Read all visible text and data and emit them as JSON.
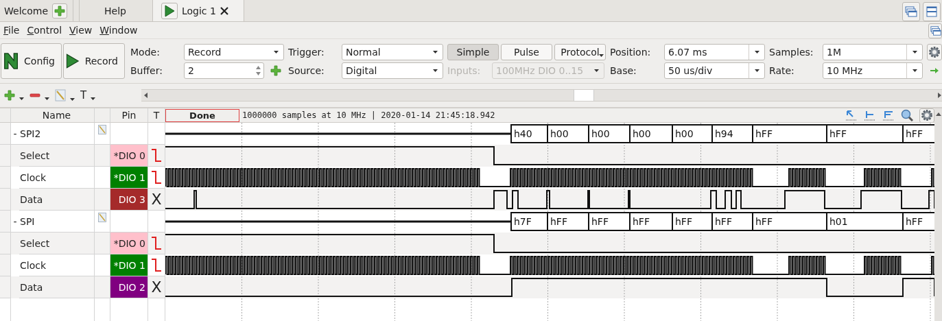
{
  "tabs": [
    {
      "label": "Welcome",
      "kind": "addable",
      "selected": false,
      "closable": false
    },
    {
      "label": "Help",
      "kind": "plain",
      "selected": false,
      "closable": false
    },
    {
      "label": "Logic 1",
      "kind": "runnable",
      "selected": true,
      "closable": true
    }
  ],
  "menu": [
    "File",
    "Control",
    "View",
    "Window"
  ],
  "actions": [
    {
      "label": "Config",
      "kind": "config"
    },
    {
      "label": "Record",
      "kind": "record"
    }
  ],
  "settings": {
    "mode": {
      "label": "Mode:",
      "value": "Record"
    },
    "buffer": {
      "label": "Buffer:",
      "value": "2"
    },
    "trigger": {
      "label": "Trigger:",
      "value": "Normal"
    },
    "source": {
      "label": "Source:",
      "value": "Digital"
    },
    "trigger_types": [
      {
        "label": "Simple",
        "selected": true,
        "menu": false
      },
      {
        "label": "Pulse",
        "selected": false,
        "menu": false
      },
      {
        "label": "Protocol",
        "selected": false,
        "menu": true
      }
    ],
    "inputs": {
      "label": "Inputs:",
      "value": "100MHz DIO 0..15",
      "disabled": true
    },
    "position": {
      "label": "Position:",
      "value": "6.07 ms"
    },
    "base": {
      "label": "Base:",
      "value": "50 us/div"
    },
    "samples": {
      "label": "Samples:",
      "value": "1M"
    },
    "rate": {
      "label": "Rate:",
      "value": "10 MHz"
    }
  },
  "edit_tools": [
    {
      "kind": "add"
    },
    {
      "kind": "remove"
    },
    {
      "kind": "pencil"
    },
    {
      "kind": "text",
      "text": "T"
    }
  ],
  "capture": {
    "status": "Done",
    "info": "1000000 samples at 10 MHz | 2020-01-14 21:45:18.942"
  },
  "columns": [
    "Name",
    "Pin",
    "T"
  ],
  "groups": [
    {
      "name": "SPI2",
      "toggle": "-",
      "expanded": true,
      "bus_values": [
        "h40",
        "h00",
        "h00",
        "h00",
        "h00",
        "h94",
        "hFF",
        "hFF",
        "hFF"
      ],
      "children": [
        {
          "name": "Select",
          "pin": "*DIO 0",
          "color": "#ffc0cb",
          "trigger": {
            "kind": "falling"
          }
        },
        {
          "name": "Clock",
          "pin": "*DIO 1",
          "color": "#008000",
          "trigger": {
            "kind": "falling"
          }
        },
        {
          "name": "Data",
          "pin": "DIO 3",
          "color": "#a52a2a",
          "trigger": {
            "kind": "label",
            "text": "X"
          }
        }
      ]
    },
    {
      "name": "SPI",
      "toggle": "-",
      "expanded": true,
      "bus_values": [
        "h7F",
        "hFF",
        "hFF",
        "hFF",
        "hFF",
        "hFF",
        "hFF",
        "h01",
        "hFF"
      ],
      "children": [
        {
          "name": "Select",
          "pin": "*DIO 0",
          "color": "#ffc0cb",
          "trigger": {
            "kind": "falling"
          }
        },
        {
          "name": "Clock",
          "pin": "*DIO 1",
          "color": "#008000",
          "trigger": {
            "kind": "falling"
          }
        },
        {
          "name": "Data",
          "pin": "DIO 2",
          "color": "#800080",
          "trigger": {
            "kind": "label",
            "text": "X"
          }
        }
      ]
    }
  ]
}
